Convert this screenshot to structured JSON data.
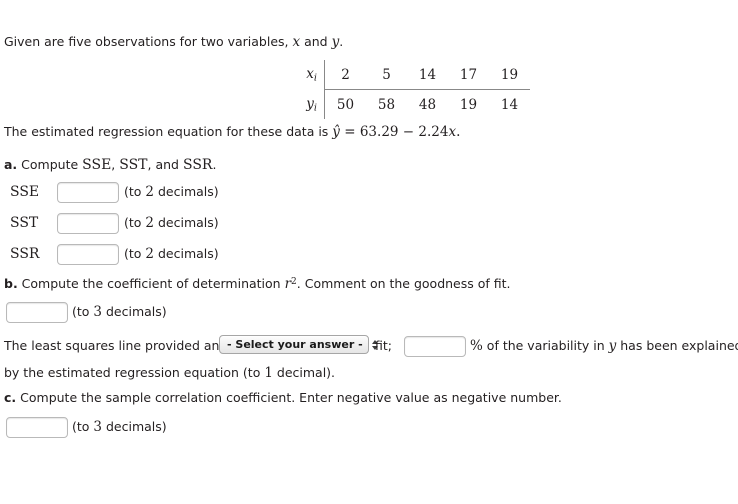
{
  "intro": {
    "text_before": "Given are five observations for two variables, ",
    "var_x": "x",
    "text_mid": " and ",
    "var_y": "y",
    "text_after": "."
  },
  "table": {
    "row_labels": [
      "x",
      "y"
    ],
    "subscript": "i",
    "x_values": [
      "2",
      "5",
      "14",
      "17",
      "19"
    ],
    "y_values": [
      "50",
      "58",
      "48",
      "19",
      "14"
    ]
  },
  "equation_line": {
    "text_before": "The estimated regression equation for these data is ",
    "y_hat": "ŷ",
    "equals": " = ",
    "intercept": "63.29",
    "operator": " − ",
    "slope": "2.24",
    "var_x": "x",
    "period": "."
  },
  "part_a": {
    "letter": "a.",
    "prompt_before": " Compute ",
    "term1": "SSE",
    "sep1": ", ",
    "term2": "SST",
    "sep2": ", and ",
    "term3": "SSR",
    "period": ".",
    "rows": [
      {
        "label": "SSE",
        "value": "",
        "hint_before": "(to ",
        "hint_num": "2",
        "hint_after": " decimals)"
      },
      {
        "label": "SST",
        "value": "",
        "hint_before": "(to ",
        "hint_num": "2",
        "hint_after": " decimals)"
      },
      {
        "label": "SSR",
        "value": "",
        "hint_before": "(to ",
        "hint_num": "2",
        "hint_after": " decimals)"
      }
    ]
  },
  "part_b": {
    "letter": "b.",
    "prompt_before": " Compute the coefficient of determination ",
    "symbol_r": "r",
    "symbol_exp": "2",
    "prompt_after": ". Comment on the goodness of fit.",
    "answer_value": "",
    "hint_before": "(to ",
    "hint_num": "3",
    "hint_after": " decimals)",
    "sentence_before": "The least squares line provided an ",
    "select_label": "- Select your answer -",
    "sentence_mid": "fit; ",
    "percent_value": "",
    "percent_symbol": "%",
    "sentence_after_percent": " of the variability in ",
    "var_y": "y",
    "sentence_tail": " has been explained",
    "second_line_before": "by the estimated regression equation (to ",
    "second_line_num": "1",
    "second_line_after": " decimal)."
  },
  "part_c": {
    "letter": "c.",
    "prompt": " Compute the sample correlation coefficient. Enter negative value as negative number.",
    "answer_value": "",
    "hint_before": "(to ",
    "hint_num": "3",
    "hint_after": " decimals)"
  }
}
